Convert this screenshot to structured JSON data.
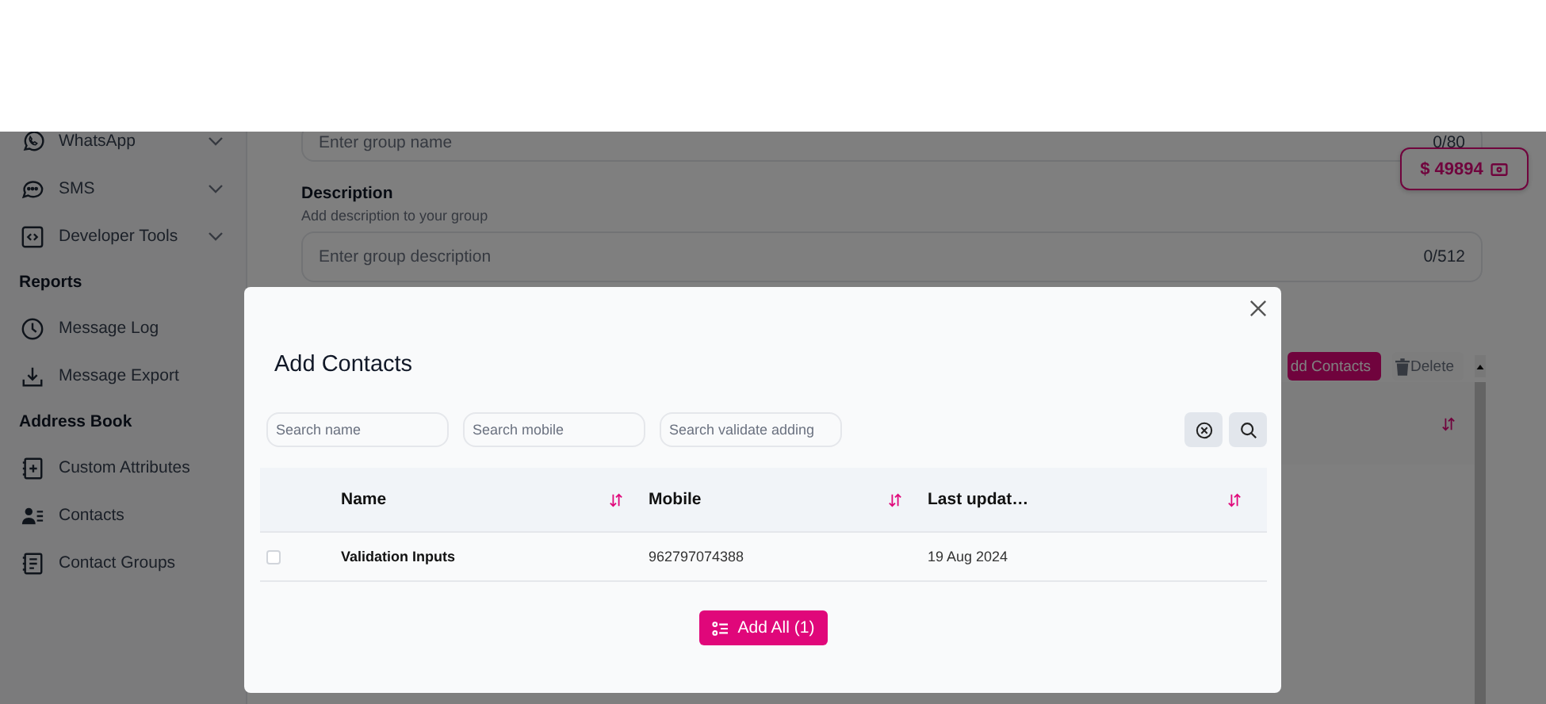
{
  "sidebar": {
    "sections": [
      {
        "items": [
          {
            "label": "WhatsApp",
            "expandable": true
          },
          {
            "label": "SMS",
            "expandable": true
          },
          {
            "label": "Developer Tools",
            "expandable": true
          }
        ]
      },
      {
        "heading": "Reports",
        "items": [
          {
            "label": "Message Log",
            "expandable": false
          },
          {
            "label": "Message Export",
            "expandable": false
          }
        ]
      },
      {
        "heading": "Address Book",
        "items": [
          {
            "label": "Custom Attributes",
            "expandable": false
          },
          {
            "label": "Contacts",
            "expandable": false
          },
          {
            "label": "Contact Groups",
            "expandable": false
          }
        ]
      }
    ]
  },
  "balance": {
    "amount": "$ 49894"
  },
  "group_form": {
    "name_field": {
      "placeholder": "Enter group name",
      "counter": "0/80"
    },
    "description": {
      "label": "Description",
      "hint": "Add description to your group",
      "placeholder": "Enter group description",
      "counter": "0/512"
    }
  },
  "toolbar": {
    "buttons": [
      {
        "label": "dd Contacts",
        "kind": "primary"
      },
      {
        "label": "Delete",
        "kind": "delete"
      }
    ]
  },
  "modal": {
    "title": "Add Contacts",
    "search_fields": [
      {
        "placeholder": "Search name"
      },
      {
        "placeholder": "Search mobile"
      },
      {
        "placeholder": "Search validate adding"
      }
    ],
    "table": {
      "columns": [
        "Name",
        "Mobile",
        "Last updat…"
      ],
      "rows": [
        {
          "checked": false,
          "cells": [
            "Validation Inputs",
            "962797074388",
            "19 Aug 2024"
          ]
        }
      ]
    },
    "add_button": "Add All (1)"
  }
}
